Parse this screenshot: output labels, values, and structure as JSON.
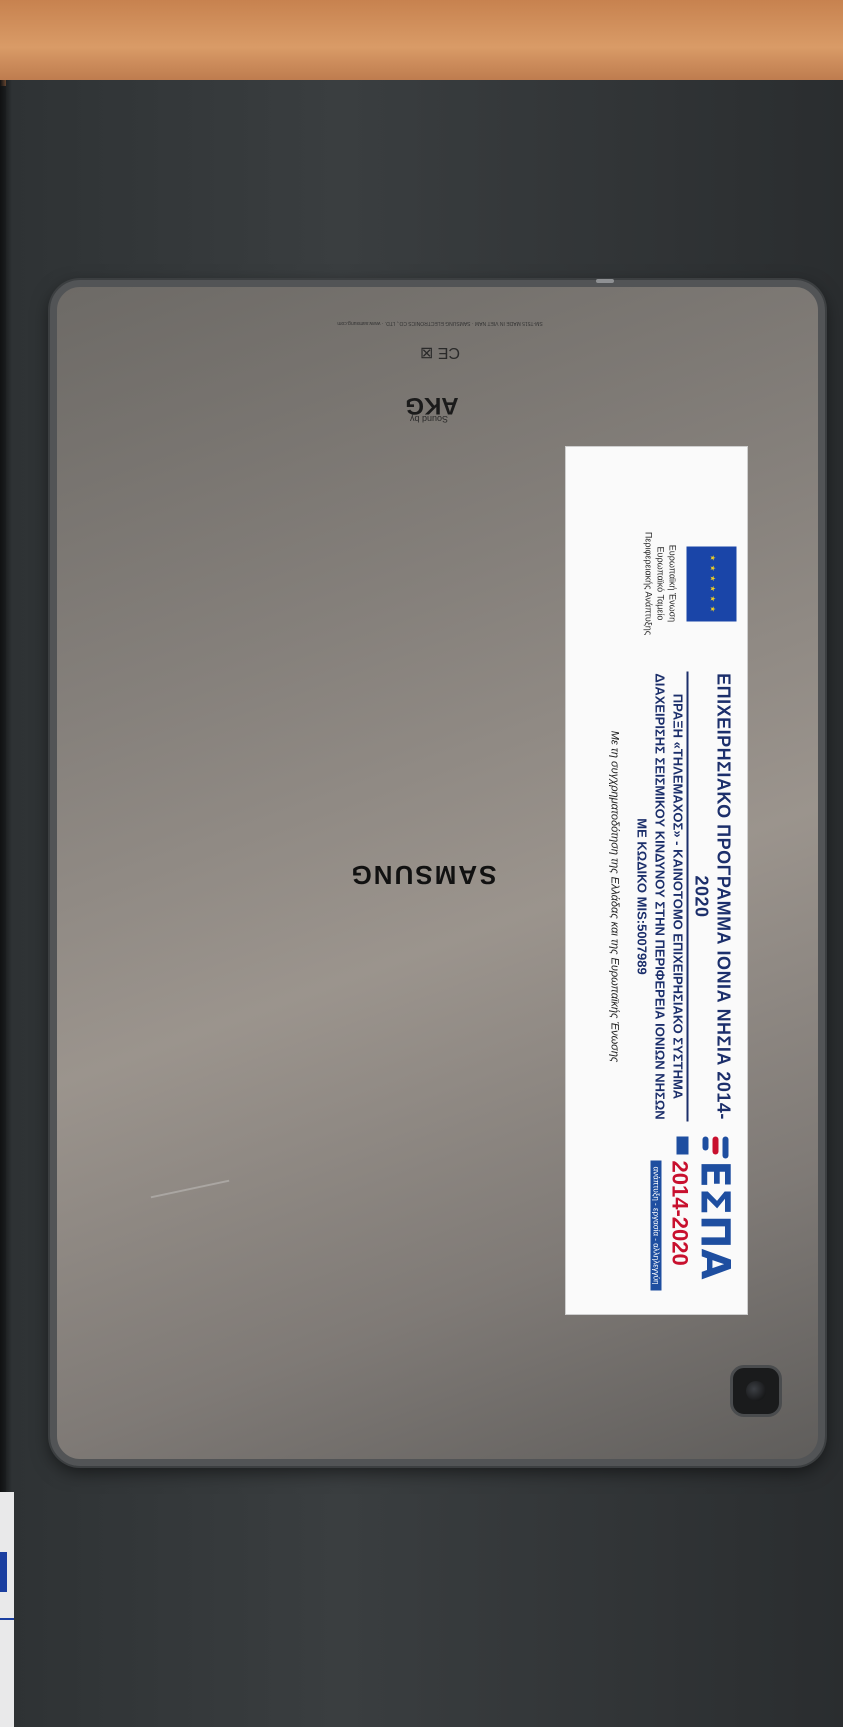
{
  "photo": {
    "description_free": true,
    "tablet": {
      "brand": "SAMSUNG",
      "audio_brand": "AKG",
      "audio_prefix": "Sound by",
      "regulatory_line": "SM-T515  MADE IN VIET NAM  ·  SAMSUNG ELECTRONICS CO., LTD.  ·  www.samsung.com",
      "marks": "CE ⊠"
    },
    "sticker": {
      "program_title": "ΕΠΙΧΕΙΡΗΣΙΑΚΟ ΠΡΟΓΡΑΜΜΑ ΙΟΝΙΑ ΝΗΣΙΑ 2014-2020",
      "line1": "ΠΡΑΞΗ «ΤΗΛΕΜΑΧΟΣ» - ΚΑΙΝΟΤΟΜΟ ΕΠΙΧΕΙΡΗΣΙΑΚΟ ΣΥΣΤΗΜΑ",
      "line2": "ΔΙΑΧΕΙΡΙΣΗΣ ΣΕΙΣΜΙΚΟΥ ΚΙΝΔΥΝΟΥ ΣΤΗΝ ΠΕΡΙΦΕΡΕΙΑ ΙΟΝΙΩΝ ΝΗΣΩΝ",
      "line3": "ΜΕ ΚΩΔΙΚΟ MIS:5007989",
      "cofinance": "Με τη συγχρηματοδότηση της Ελλάδας και της Ευρωπαϊκής Ένωσης",
      "eu_label_1": "Ευρωπαϊκή Ένωση",
      "eu_label_2": "Ευρωπαϊκό Ταμείο",
      "eu_label_3": "Περιφερειακής Ανάπτυξης",
      "espa_logo": "ΕΣΠΑ",
      "espa_years": "2014-2020",
      "espa_tag": "ανάπτυξη - εργασία - αλληλεγγύη",
      "colors": {
        "eu_blue": "#1a45a8",
        "espa_blue": "#1e4ea0",
        "espa_red": "#c8102e"
      }
    }
  }
}
